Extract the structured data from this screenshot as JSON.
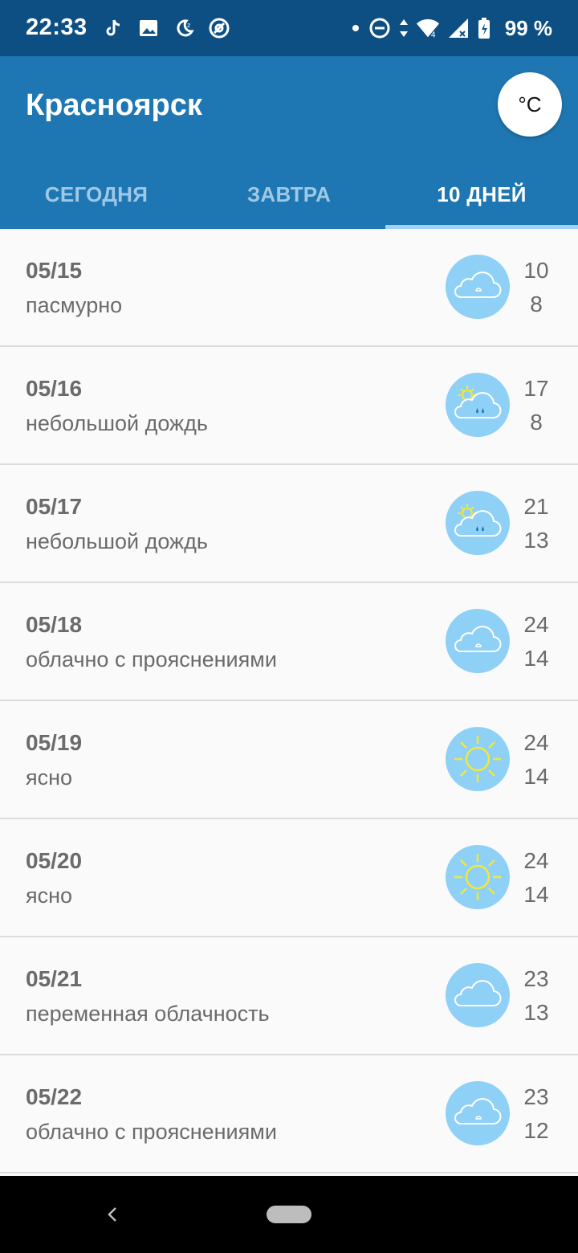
{
  "status_bar": {
    "time": "22:33",
    "battery_text": "99 %",
    "left_icons": [
      "tiktok-icon",
      "image-icon",
      "night-mode-icon",
      "at-sign-icon"
    ],
    "right_icons": [
      "notification-dot-icon",
      "dnd-icon",
      "data-arrows-icon",
      "wifi-icon",
      "signal-icon",
      "battery-icon"
    ]
  },
  "app_bar": {
    "city": "Красноярск",
    "unit_label": "°C",
    "colors": {
      "status": "#0d4f82",
      "appbar": "#1e77b2"
    }
  },
  "tabs": [
    {
      "label": "СЕГОДНЯ",
      "active": false
    },
    {
      "label": "ЗАВТРА",
      "active": false
    },
    {
      "label": "10 ДНЕЙ",
      "active": true
    }
  ],
  "forecast": [
    {
      "date": "05/15",
      "desc": "пасмурно",
      "high": "10",
      "low": "8",
      "icon": "overcast-icon"
    },
    {
      "date": "05/16",
      "desc": "небольшой дождь",
      "high": "17",
      "low": "8",
      "icon": "sun-cloud-rain-icon"
    },
    {
      "date": "05/17",
      "desc": "небольшой дождь",
      "high": "21",
      "low": "13",
      "icon": "sun-cloud-rain-icon"
    },
    {
      "date": "05/18",
      "desc": "облачно с прояснениями",
      "high": "24",
      "low": "14",
      "icon": "cloudy-icon"
    },
    {
      "date": "05/19",
      "desc": "ясно",
      "high": "24",
      "low": "14",
      "icon": "sun-icon"
    },
    {
      "date": "05/20",
      "desc": "ясно",
      "high": "24",
      "low": "14",
      "icon": "sun-icon"
    },
    {
      "date": "05/21",
      "desc": "переменная облачность",
      "high": "23",
      "low": "13",
      "icon": "cloud-icon"
    },
    {
      "date": "05/22",
      "desc": "облачно с прояснениями",
      "high": "23",
      "low": "12",
      "icon": "cloudy-icon"
    }
  ],
  "nav": {
    "back_icon": "back-icon",
    "home_icon": "home-pill-icon"
  }
}
